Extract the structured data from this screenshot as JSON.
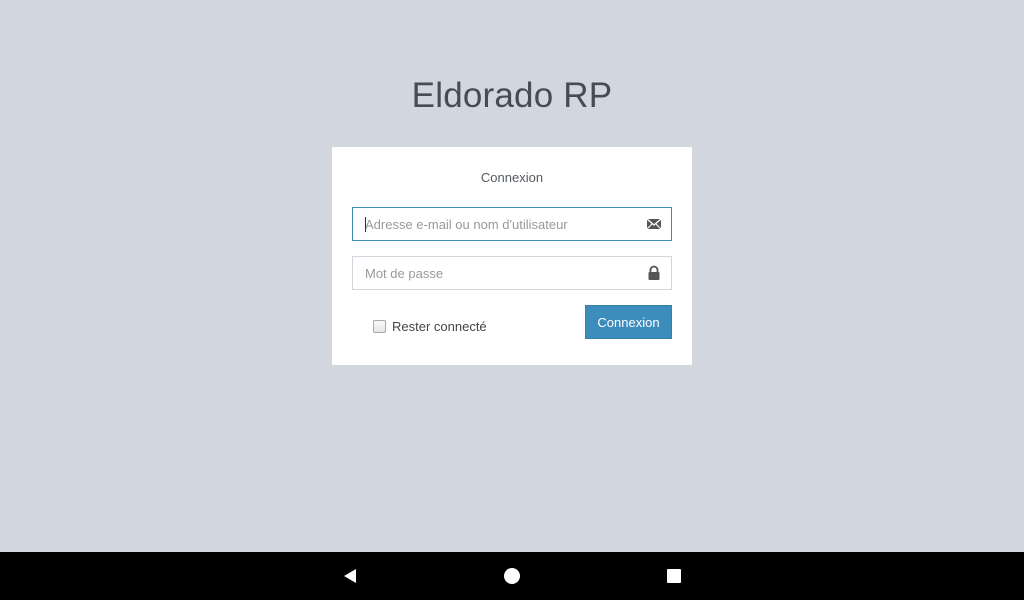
{
  "app": {
    "brand": "Eldorado RP"
  },
  "login": {
    "title": "Connexion",
    "email_placeholder": "Adresse e-mail ou nom d'utilisateur",
    "email_value": "",
    "password_placeholder": "Mot de passe",
    "password_value": "",
    "remember_label": "Rester connecté",
    "remember_checked": false,
    "submit_label": "Connexion"
  },
  "icons": {
    "email": "envelope-icon",
    "password": "lock-icon"
  },
  "colors": {
    "background": "#d2d6de",
    "accent": "#3c8dbc",
    "box": "#ffffff",
    "navbar": "#000000"
  }
}
